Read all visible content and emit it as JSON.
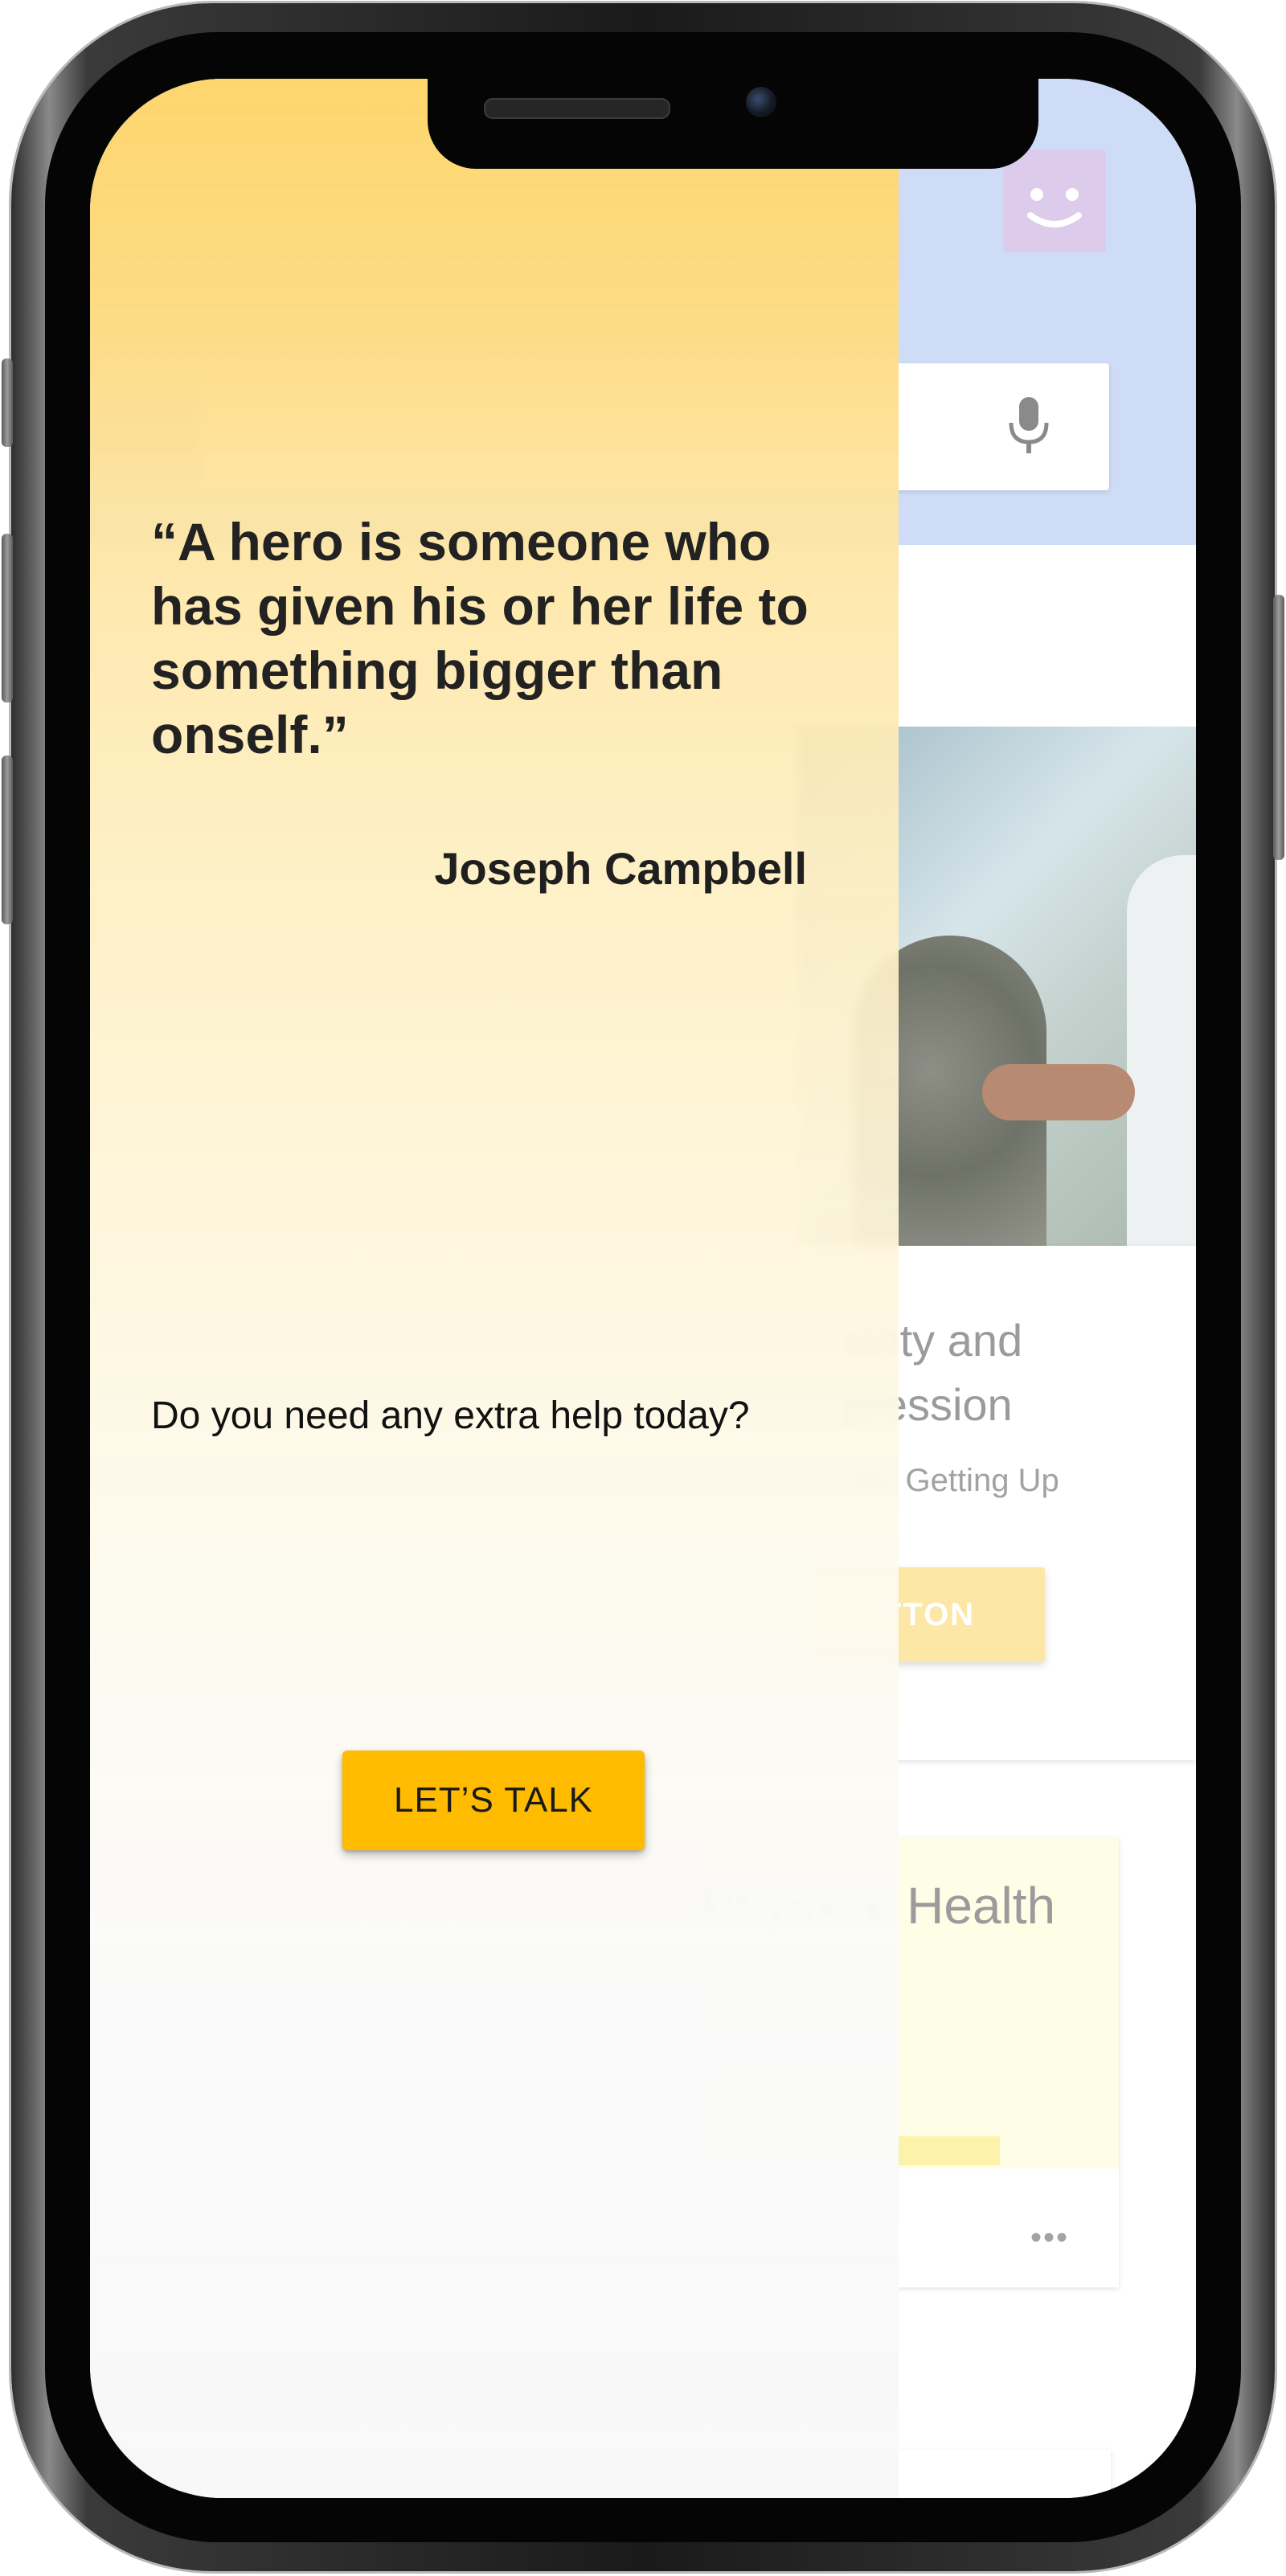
{
  "quote": {
    "text": "“A hero is someone who has given his or her life to something bigger than onself.”",
    "author": "Joseph Campbell"
  },
  "prompt": {
    "question": "Do you need any extra help today?",
    "button_label": "LET’S TALK"
  },
  "background": {
    "card_title": "xiety and\npression",
    "card_subtitle": "ay: Getting Up",
    "card_button": "TTON",
    "health_card_title": "Physical Health"
  },
  "colors": {
    "accent": "#ffbb00",
    "header_blue": "#cfdcf7",
    "overlay_top": "#fed66e"
  },
  "icons": [
    "smiley-icon",
    "microphone-icon",
    "more-horizontal-icon"
  ]
}
